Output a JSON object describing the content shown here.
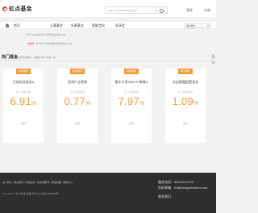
{
  "brand": {
    "logo_text": "虹点基金"
  },
  "topbar": {
    "search_placeholder": "请输入基金代码或基金名称",
    "login": "登录",
    "register": "注册"
  },
  "nav": {
    "items": [
      "首页",
      "公募基金",
      "私募基金",
      "智能定投",
      "私享会"
    ],
    "select_value": "我的账户"
  },
  "announcements": {
    "first": "关于XX基金暂停大额申购业务的公告",
    "second_tag": "【最新】",
    "second": "关于旗下基金调整业务规则的公告"
  },
  "hot": {
    "title": "热门基金",
    "subtitle": "优选基金推荐，数据来源于基金公司",
    "more": "更多"
  },
  "cards": [
    {
      "badge": "精选推荐",
      "name": "天成优选混合A",
      "label": "近一年收益率",
      "rate": "6.91",
      "unit": "%",
      "buy": "购买"
    },
    {
      "badge": "精选推荐",
      "name": "恒润产业债券",
      "label": "近一年收益率",
      "rate": "0.77",
      "unit": "%",
      "buy": "购买"
    },
    {
      "badge": "精选推荐",
      "name": "鼎丰沪深300ETF联接A",
      "label": "近一年收益率",
      "rate": "7.97",
      "unit": "%",
      "buy": "购买"
    },
    {
      "badge": "精选推荐",
      "name": "永益稳健配置混合",
      "label": "近一年收益率",
      "rate": "1.09",
      "unit": "%",
      "buy": "购买"
    }
  ],
  "footer": {
    "links": "关于我们 | 联系我们 | 风险提示 | 投资者教育 | 网站地图 | 帮助中心",
    "copyright": "Copyright © 虹点基金 版权所有 沪ICP备00000000号",
    "phone": "服务电话：400-820-0707",
    "email_label": "投诉邮箱：hd@hongdianfund.com",
    "contact_us": "联系我们"
  }
}
